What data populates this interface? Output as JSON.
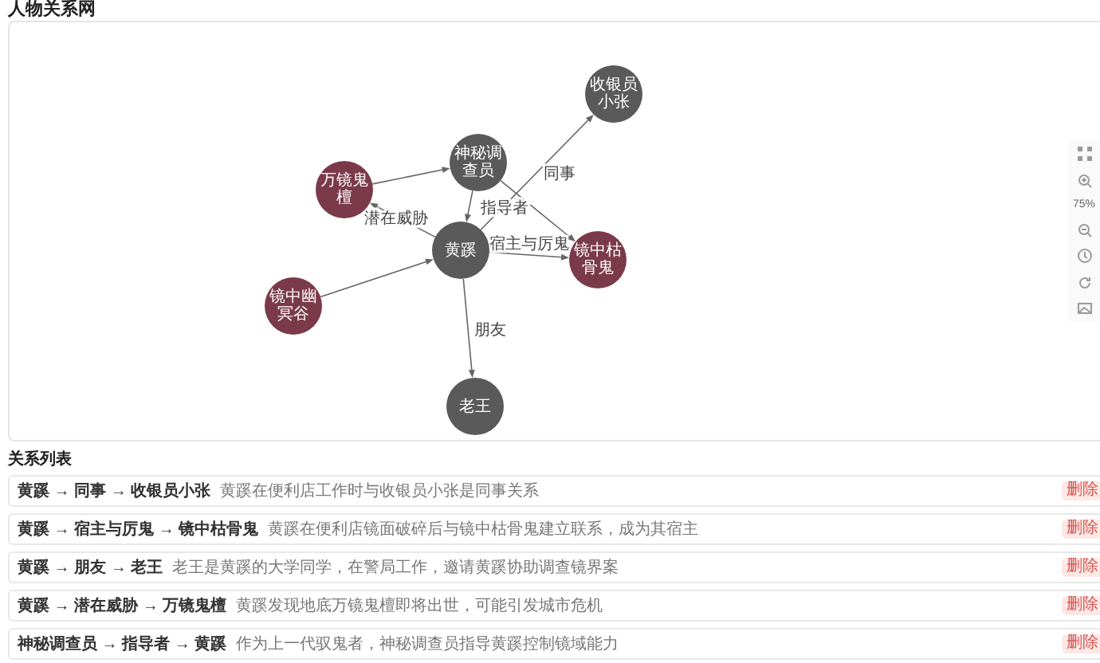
{
  "title": "人物关系网",
  "graph": {
    "nodes": [
      {
        "label": "黄蹊",
        "color": "#5a5a5a"
      },
      {
        "label": "收银员小张",
        "color": "#5a5a5a"
      },
      {
        "label": "神秘调查员",
        "color": "#5a5a5a"
      },
      {
        "label": "万镜鬼檀",
        "color": "#7a3a4a"
      },
      {
        "label": "镜中枯骨鬼",
        "color": "#7a3a4a"
      },
      {
        "label": "镜中幽冥谷",
        "color": "#7a3a4a"
      },
      {
        "label": "老王",
        "color": "#5a5a5a"
      }
    ],
    "edges": [
      {
        "label": "同事"
      },
      {
        "label": "指导者"
      },
      {
        "label": "宿主与厉鬼"
      },
      {
        "label": "朋友"
      },
      {
        "label": "潜在威胁"
      }
    ]
  },
  "toolbar": {
    "zoom": "75%"
  },
  "list_title": "关系列表",
  "relations": [
    {
      "path": "黄蹊 → 同事 → 收银员小张",
      "description": "黄蹊在便利店工作时与收银员小张是同事关系",
      "delete": "删除"
    },
    {
      "path": "黄蹊 → 宿主与厉鬼 → 镜中枯骨鬼",
      "description": "黄蹊在便利店镜面破碎后与镜中枯骨鬼建立联系，成为其宿主",
      "delete": "删除"
    },
    {
      "path": "黄蹊 → 朋友 → 老王",
      "description": "老王是黄蹊的大学同学，在警局工作，邀请黄蹊协助调查镜界案",
      "delete": "删除"
    },
    {
      "path": "黄蹊 → 潜在威胁 → 万镜鬼檀",
      "description": "黄蹊发现地底万镜鬼檀即将出世，可能引发城市危机",
      "delete": "删除"
    },
    {
      "path": "神秘调查员 → 指导者 → 黄蹊",
      "description": "作为上一代驭鬼者，神秘调查员指导黄蹊控制镜域能力",
      "delete": "删除"
    }
  ]
}
